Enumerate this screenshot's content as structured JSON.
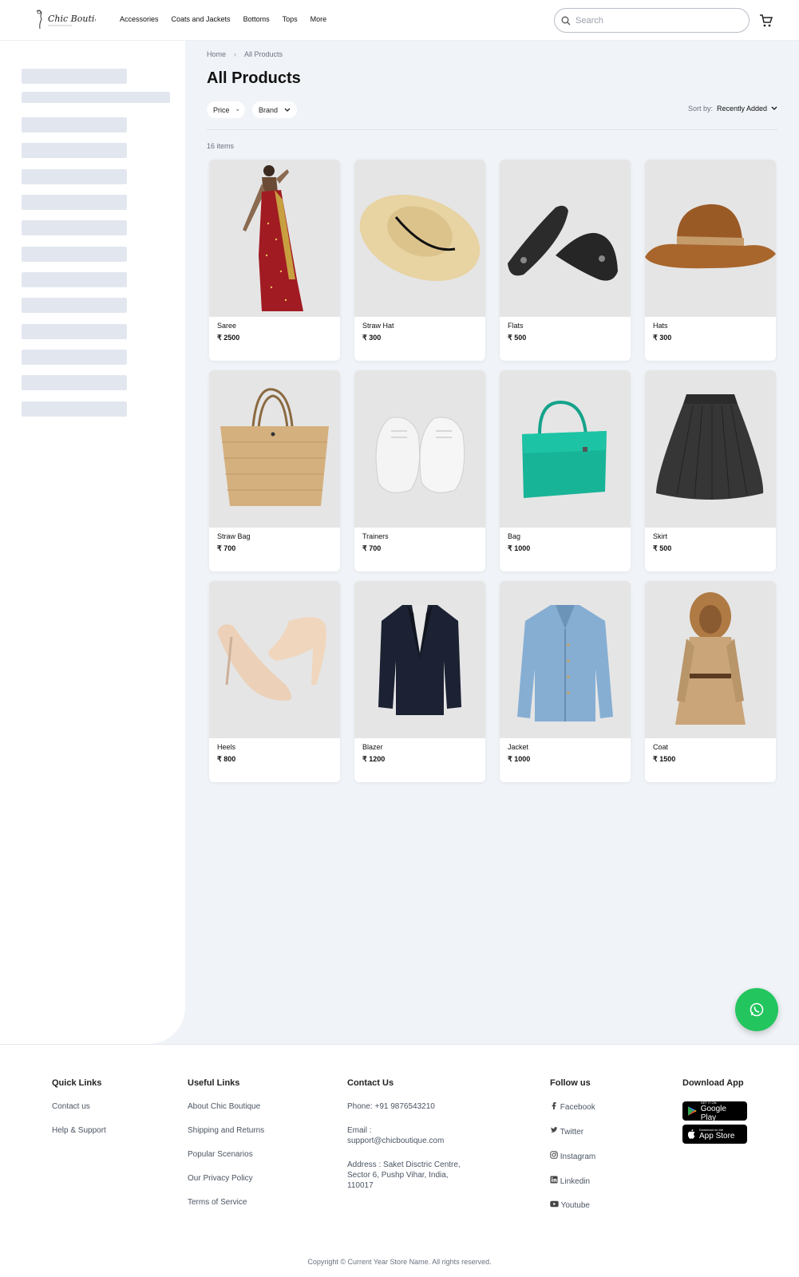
{
  "header": {
    "logo_text": "Chic Boutique",
    "nav": [
      "Accessories",
      "Coats and Jackets",
      "Bottoms",
      "Tops",
      "More"
    ],
    "search_placeholder": "Search"
  },
  "breadcrumb": {
    "home": "Home",
    "current": "All Products"
  },
  "page_title": "All Products",
  "filters": {
    "price": "Price",
    "brand": "Brand"
  },
  "sort": {
    "label": "Sort by:",
    "value": "Recently Added"
  },
  "item_count": "16 items",
  "products": [
    {
      "name": "Saree",
      "price": "₹ 2500",
      "icon": "saree-image"
    },
    {
      "name": "Straw Hat",
      "price": "₹ 300",
      "icon": "straw-hat-image"
    },
    {
      "name": "Flats",
      "price": "₹ 500",
      "icon": "flats-image"
    },
    {
      "name": "Hats",
      "price": "₹ 300",
      "icon": "cowboy-hat-image"
    },
    {
      "name": "Straw Bag",
      "price": "₹ 700",
      "icon": "straw-bag-image"
    },
    {
      "name": "Trainers",
      "price": "₹ 700",
      "icon": "trainers-image"
    },
    {
      "name": "Bag",
      "price": "₹ 1000",
      "icon": "handbag-image"
    },
    {
      "name": "Skirt",
      "price": "₹ 500",
      "icon": "skirt-image"
    },
    {
      "name": "Heels",
      "price": "₹ 800",
      "icon": "heels-image"
    },
    {
      "name": "Blazer",
      "price": "₹ 1200",
      "icon": "blazer-image"
    },
    {
      "name": "Jacket",
      "price": "₹ 1000",
      "icon": "jacket-image"
    },
    {
      "name": "Coat",
      "price": "₹ 1500",
      "icon": "coat-image"
    }
  ],
  "footer": {
    "quick_links": {
      "title": "Quick Links",
      "items": [
        "Contact us",
        "Help & Support"
      ]
    },
    "useful_links": {
      "title": "Useful Links",
      "items": [
        "About Chic Boutique",
        "Shipping and Returns",
        "Popular Scenarios",
        "Our Privacy Policy",
        "Terms of Service"
      ]
    },
    "contact": {
      "title": "Contact Us",
      "phone": "Phone: +91 9876543210",
      "email": "Email : support@chicboutique.com",
      "address": "Address : Saket Disctric Centre, Sector 6, Pushp Vihar, India, 110017"
    },
    "follow": {
      "title": "Follow us",
      "items": [
        "Facebook",
        "Twitter",
        "Instagram",
        "Linkedin",
        "Youtube"
      ]
    },
    "download": {
      "title": "Download App",
      "google_small": "GET IT ON",
      "google_large": "Google Play",
      "apple_small": "Download on the",
      "apple_large": "App Store"
    },
    "copyright": "Copyright © Current Year Store Name. All rights reserved."
  },
  "colors": {
    "accent_green": "#22c55e",
    "page_bg": "#f0f3f7",
    "skeleton": "#e2e7ef"
  }
}
